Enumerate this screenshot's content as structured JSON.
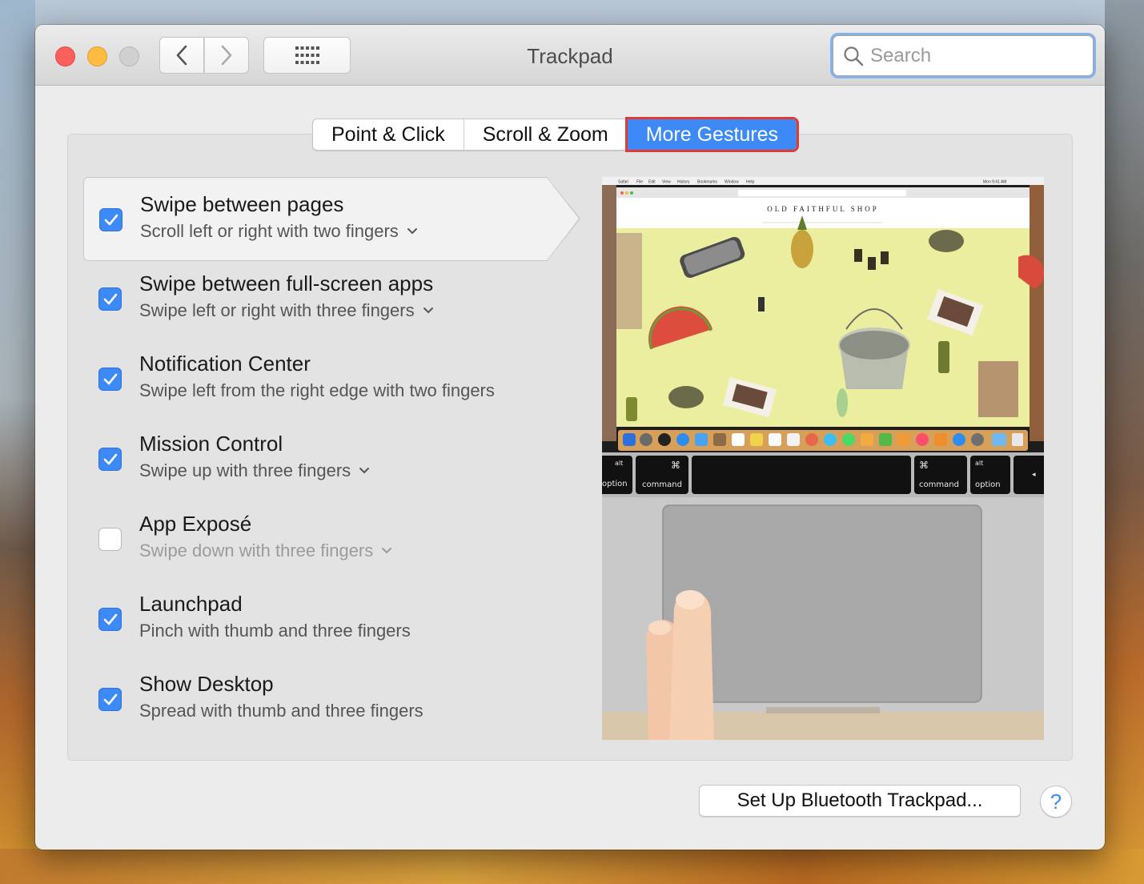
{
  "window": {
    "title": "Trackpad"
  },
  "search": {
    "placeholder": "Search"
  },
  "tabs": [
    {
      "label": "Point & Click"
    },
    {
      "label": "Scroll & Zoom"
    },
    {
      "label": "More Gestures"
    }
  ],
  "gestures": [
    {
      "title": "Swipe between pages",
      "subtitle": "Scroll left or right with two fingers",
      "checked": true,
      "has_dropdown": true
    },
    {
      "title": "Swipe between full-screen apps",
      "subtitle": "Swipe left or right with three fingers",
      "checked": true,
      "has_dropdown": true
    },
    {
      "title": "Notification Center",
      "subtitle": "Swipe left from the right edge with two fingers",
      "checked": true,
      "has_dropdown": false
    },
    {
      "title": "Mission Control",
      "subtitle": "Swipe up with three fingers",
      "checked": true,
      "has_dropdown": true
    },
    {
      "title": "App Exposé",
      "subtitle": "Swipe down with three fingers",
      "checked": false,
      "has_dropdown": true
    },
    {
      "title": "Launchpad",
      "subtitle": "Pinch with thumb and three fingers",
      "checked": true,
      "has_dropdown": false
    },
    {
      "title": "Show Desktop",
      "subtitle": "Spread with thumb and three fingers",
      "checked": true,
      "has_dropdown": false
    }
  ],
  "preview": {
    "menubar": [
      "Safari",
      "File",
      "Edit",
      "View",
      "History",
      "Bookmarks",
      "Window",
      "Help"
    ],
    "clock": "Mon 9:41 AM",
    "shop_name": "OLD FAITHFUL SHOP",
    "keys": {
      "k1_top": "alt",
      "k1_bottom": "option",
      "k2_top": "⌘",
      "k2_bottom": "command",
      "k3_top": "⌘",
      "k3_bottom": "command",
      "k4_top": "alt",
      "k4_bottom": "option",
      "k5": "◂"
    }
  },
  "buttons": {
    "setup": "Set Up Bluetooth Trackpad...",
    "help": "?"
  },
  "colors": {
    "accent": "#3d8af7",
    "highlight_outline": "#e23a2e",
    "close": "#fc605c",
    "minimize": "#fdbc40"
  }
}
